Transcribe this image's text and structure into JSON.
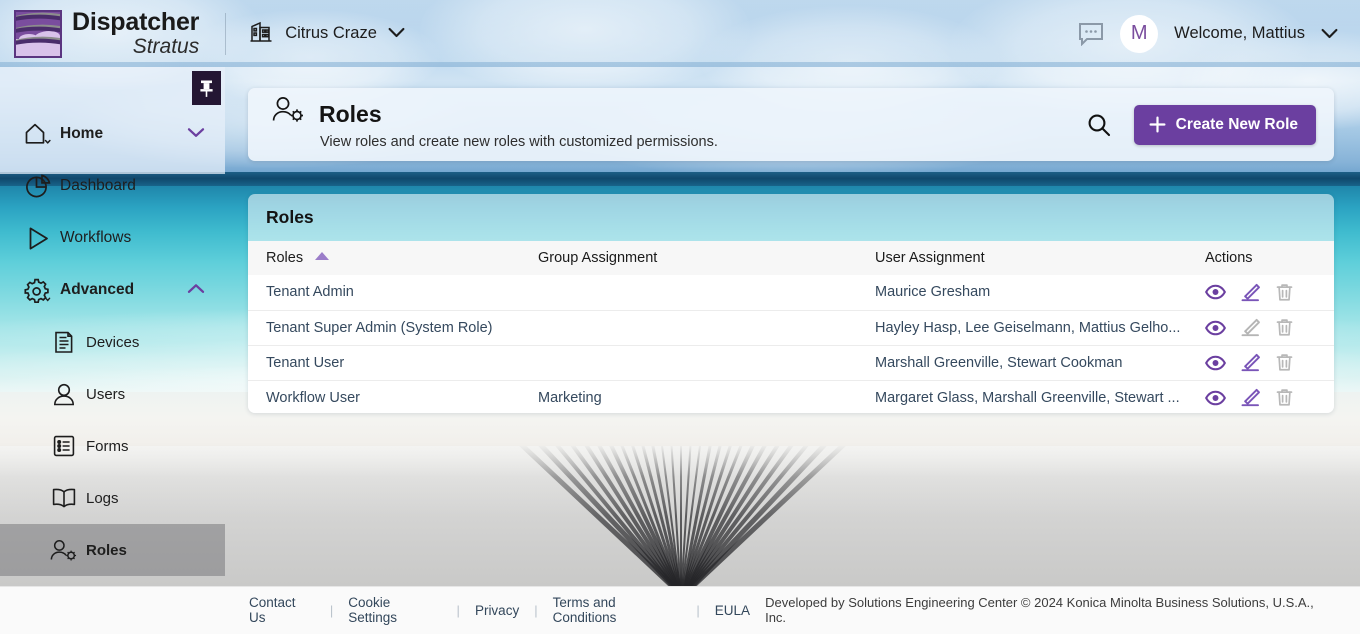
{
  "brand": {
    "name_line1": "Dispatcher",
    "name_line2": "Stratus",
    "logo_icon": "dispatcher-stratus-logo",
    "accent_color": "#6b3fa0"
  },
  "topbar": {
    "tenant_icon": "building-icon",
    "tenant_name": "Citrus Craze",
    "tenant_chevron_icon": "chevron-down-icon",
    "chat_icon": "chat-bubble-icon",
    "avatar_initial": "M",
    "welcome_text": "Welcome, Mattius",
    "user_chevron_icon": "chevron-down-icon"
  },
  "sidebar": {
    "pin_icon": "pin-icon",
    "items": [
      {
        "label": "Home",
        "icon": "home-icon",
        "type": "group",
        "expanded": true,
        "chevron": "chevron-down-icon",
        "active": false
      },
      {
        "label": "Dashboard",
        "icon": "pie-chart-icon",
        "type": "item",
        "active": false
      },
      {
        "label": "Workflows",
        "icon": "play-triangle-icon",
        "type": "item",
        "active": false
      },
      {
        "label": "Advanced",
        "icon": "gear-icon",
        "type": "group",
        "expanded": true,
        "chevron": "chevron-up-icon",
        "active": false
      },
      {
        "label": "Devices",
        "icon": "device-icon",
        "type": "child",
        "active": false
      },
      {
        "label": "Users",
        "icon": "user-icon",
        "type": "child",
        "active": false
      },
      {
        "label": "Forms",
        "icon": "list-icon",
        "type": "child",
        "active": false
      },
      {
        "label": "Logs",
        "icon": "book-icon",
        "type": "child",
        "active": false
      },
      {
        "label": "Roles",
        "icon": "roles-icon",
        "type": "child",
        "active": true
      }
    ]
  },
  "page_header": {
    "icon": "roles-icon",
    "title": "Roles",
    "subtitle": "View roles and create new roles with customized permissions.",
    "search_icon": "search-icon",
    "create_button_label": "Create New Role",
    "create_button_icon": "plus-icon"
  },
  "table_card": {
    "title": "Roles",
    "columns": [
      {
        "label": "Roles",
        "sorted": true,
        "sort_icon": "sort-ascending-triangle-icon"
      },
      {
        "label": "Group Assignment",
        "sorted": false
      },
      {
        "label": "User Assignment",
        "sorted": false
      },
      {
        "label": "Actions",
        "sorted": false
      }
    ],
    "rows": [
      {
        "role": "Tenant Admin",
        "group_assignment": "",
        "user_assignment": "Maurice Gresham",
        "actions": {
          "view": "enabled",
          "edit": "enabled",
          "delete": "disabled"
        }
      },
      {
        "role": "Tenant Super Admin (System Role)",
        "group_assignment": "",
        "user_assignment": "Hayley Hasp, Lee Geiselmann, Mattius Gelho...",
        "actions": {
          "view": "enabled",
          "edit": "disabled",
          "delete": "disabled"
        }
      },
      {
        "role": "Tenant User",
        "group_assignment": "",
        "user_assignment": "Marshall Greenville, Stewart Cookman",
        "actions": {
          "view": "enabled",
          "edit": "enabled",
          "delete": "disabled"
        }
      },
      {
        "role": "Workflow User",
        "group_assignment": "Marketing",
        "user_assignment": "Margaret Glass, Marshall Greenville, Stewart ...",
        "actions": {
          "view": "enabled",
          "edit": "enabled",
          "delete": "disabled"
        }
      }
    ],
    "action_icons": {
      "view": "eye-icon",
      "edit": "pencil-icon",
      "delete": "trash-icon"
    }
  },
  "footer": {
    "links": [
      "Contact Us",
      "Cookie Settings",
      "Privacy",
      "Terms and Conditions",
      "EULA"
    ],
    "separator": "|",
    "copyright": "Developed by Solutions Engineering Center © 2024 Konica Minolta Business Solutions, U.S.A., Inc."
  }
}
